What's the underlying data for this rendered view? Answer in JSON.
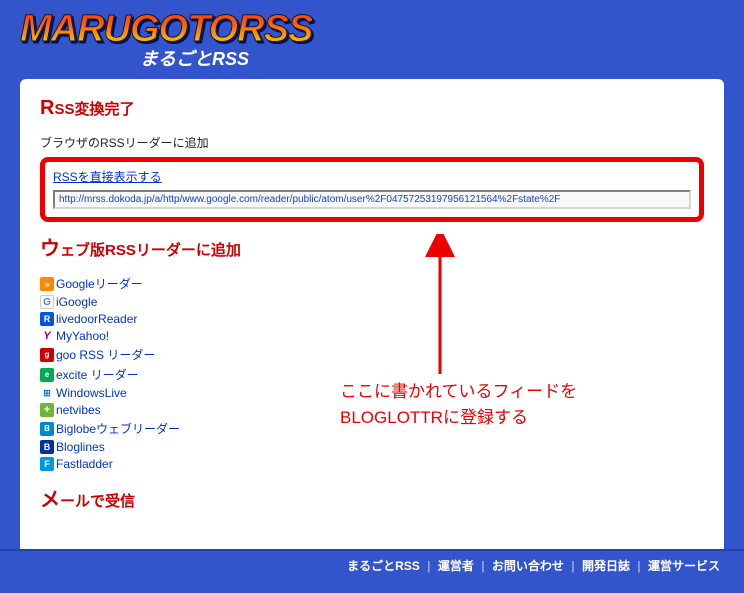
{
  "header": {
    "logo": "MARUGOTORSS",
    "subtitle": "まるごとRSS"
  },
  "main": {
    "title_rss": "R",
    "title_rest": "SS変換完了",
    "browser_label": "ブラウザのRSSリーダーに追加",
    "direct_link": "RSSを直接表示する",
    "url_value": "http://mrss.dokoda.jp/a/http/www.google.com/reader/public/atom/user%2F04757253197956121564%2Fstate%2F",
    "web_title_char": "ウ",
    "web_title_rest": "ェブ版RSSリーダーに追加",
    "readers": [
      {
        "icon": "ic-rss",
        "glyph": "»",
        "label": "Googleリーダー"
      },
      {
        "icon": "ic-g",
        "glyph": "G",
        "label": "iGoogle"
      },
      {
        "icon": "ic-r",
        "glyph": "R",
        "label": "livedoorReader"
      },
      {
        "icon": "ic-y",
        "glyph": "Y",
        "label": "MyYahoo!"
      },
      {
        "icon": "ic-goo",
        "glyph": "g",
        "label": "goo RSS リーダー"
      },
      {
        "icon": "ic-ex",
        "glyph": "e",
        "label": "excite リーダー"
      },
      {
        "icon": "ic-wl",
        "glyph": "⊞",
        "label": "WindowsLive"
      },
      {
        "icon": "ic-nv",
        "glyph": "+",
        "label": "netvibes"
      },
      {
        "icon": "ic-bg",
        "glyph": "B",
        "label": "Biglobeウェブリーダー"
      },
      {
        "icon": "ic-bl",
        "glyph": "B",
        "label": "Bloglines"
      },
      {
        "icon": "ic-fl",
        "glyph": "F",
        "label": "Fastladder"
      }
    ],
    "mail_title_char": "メ",
    "mail_title_rest": "ールで受信"
  },
  "annotation": {
    "line1": "ここに書かれているフィードを",
    "line2": "BLOGLOTTRに登録する"
  },
  "footer": {
    "items": [
      "まるごとRSS",
      "運営者",
      "お問い合わせ",
      "開発日誌",
      "運営サービス"
    ]
  }
}
